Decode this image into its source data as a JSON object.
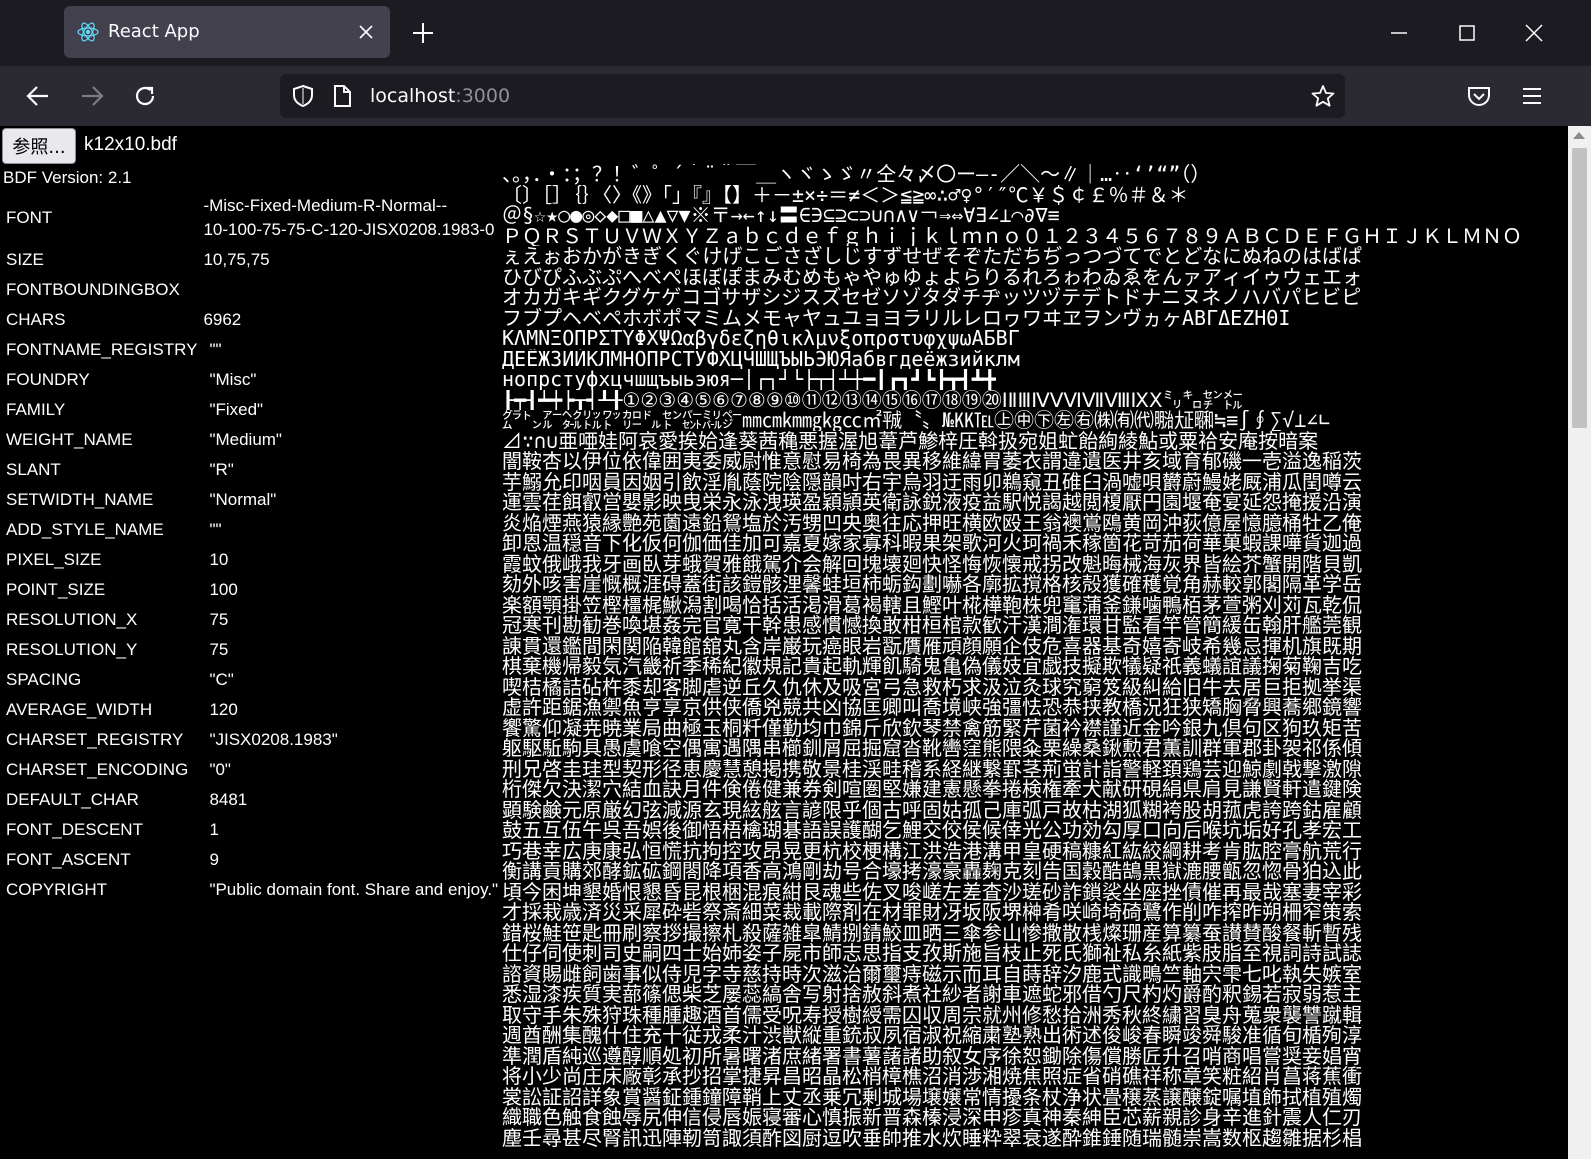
{
  "browser": {
    "tab_title": "React App",
    "url_host": "localhost",
    "url_port": ":3000"
  },
  "file_input": {
    "button_label": "参照...",
    "file_name": "k12x10.bdf"
  },
  "bdf_version": "BDF Version: 2.1",
  "properties": [
    {
      "key": "FONT",
      "value": "-Misc-Fixed-Medium-R-Normal--",
      "value2": "10-100-75-75-C-120-JISX0208.1983-0"
    },
    {
      "key": "SIZE",
      "value": "10,75,75"
    },
    {
      "key": "FONTBOUNDINGBOX",
      "value": ""
    },
    {
      "key": "CHARS",
      "value": "6962"
    },
    {
      "key": "FONTNAME_REGISTRY",
      "value": "\"\""
    },
    {
      "key": "FOUNDRY",
      "value": "\"Misc\""
    },
    {
      "key": "FAMILY",
      "value": "\"Fixed\""
    },
    {
      "key": "WEIGHT_NAME",
      "value": "\"Medium\""
    },
    {
      "key": "SLANT",
      "value": "\"R\""
    },
    {
      "key": "SETWIDTH_NAME",
      "value": "\"Normal\""
    },
    {
      "key": "ADD_STYLE_NAME",
      "value": "\"\""
    },
    {
      "key": "PIXEL_SIZE",
      "value": "10"
    },
    {
      "key": "POINT_SIZE",
      "value": "100"
    },
    {
      "key": "RESOLUTION_X",
      "value": "75"
    },
    {
      "key": "RESOLUTION_Y",
      "value": "75"
    },
    {
      "key": "SPACING",
      "value": "\"C\""
    },
    {
      "key": "AVERAGE_WIDTH",
      "value": "120"
    },
    {
      "key": "CHARSET_REGISTRY",
      "value": "\"JISX0208.1983\""
    },
    {
      "key": "CHARSET_ENCODING",
      "value": "\"0\""
    },
    {
      "key": "DEFAULT_CHAR",
      "value": "8481"
    },
    {
      "key": "FONT_DESCENT",
      "value": "1"
    },
    {
      "key": "FONT_ASCENT",
      "value": "9"
    },
    {
      "key": "COPYRIGHT",
      "value": "\"Public domain font. Share and enjoy.\""
    }
  ],
  "glyph_rows": [
    "、。，．・：；？！゛゜´｀¨＾￣＿ヽヾゝゞ〃仝々〆〇ー―‐／＼～∥｜…‥‘’“”（）",
    "〔〕［］｛｝〈〉《》「」『』【】＋－±×÷＝≠＜＞≦≧∞∴♂♀°′″℃￥＄￠￡％＃＆＊",
    "＠§☆★○●◎◇◆□■△▲▽▼※〒→←↑↓〓∈∋⊆⊇⊂⊃∪∩∧∨￢⇒⇔∀∃∠⊥⌒∂∇≡",
    "ＰＱＲＳＴＵＶＷＸＹＺａｂｃｄｅｆｇｈｉｊｋｌｍｎｏ０１２３４５６７８９ＡＢＣＤＥＦＧＨＩＪＫＬＭＮＯ",
    "ぇえぉおかがきぎくぐけげこごさざしじすずせぜそぞただちぢっつづてでとどなにぬねのはばぱ",
    "ひびぴふぶぷへべぺほぼぽまみむめもゃやゅゆょよらりるれろゎわゐゑをんァアィイゥウェエォ",
    "オカガキギクグケゲコゴサザシジスズセゼソゾタダチヂッツヅテデトドナニヌネノハバパヒビピ",
    "フブプヘベペホボポマミムメモャヤュユョヨラリルレロヮワヰヱヲンヴヵヶΑΒΓΔΕΖΗΘΙ",
    "ΚΛΜΝΞΟΠΡΣΤΥΦΧΨΩαβγδεζηθικλμνξοπρστυφχψωАБВГ",
    "ДЕЁЖЗИЙКЛМНОПРСТУФХЦЧШЩЪЫЬЭЮЯабвгдеёжзийклм",
    "нопрстуфхцчшщъыьэюя─│┌┐┘└├┬┤┴┼━┃┏┓┛┗┣┳┫┻╋",
    "┠┯┨┷┿┝┰┥┸╂①②③④⑤⑥⑦⑧⑨⑩⑪⑫⑬⑭⑮⑯⑰⑱⑲⑳ⅠⅡⅢⅣⅤⅥⅦⅧⅨⅩ㍉㌔㌢㍍",
    "㌘㌧㌃㌶㍑㍗㌍㌦㌣㌫㍊㌻㎜㎝㎞㎎㎏㏄㎡㍻〝〟№㏍℡㊤㊥㊦㊧㊨㈱㈲㈹㍾㍽㍼≒≡∫∮∑√⊥∠∟",
    "⊿∵∩∪亜唖娃阿哀愛挨姶逢葵茜穐悪握渥旭葦芦鯵梓圧斡扱宛姐虻飴絢綾鮎或粟袷安庵按暗案",
    "闇鞍杏以伊位依偉囲夷委威尉惟意慰易椅為畏異移維緯胃萎衣謂違遺医井亥域育郁磯一壱溢逸稲茨",
    "芋鰯允印咽員因姻引飲淫胤蔭院陰隠韻吋右宇烏羽迂雨卯鵜窺丑碓臼渦嘘唄欝蔚鰻姥厩浦瓜閏噂云",
    "運雲荏餌叡営嬰影映曳栄永泳洩瑛盈穎頴英衛詠鋭液疫益駅悦謁越閲榎厭円園堰奄宴延怨掩援沿演",
    "炎焔煙燕猿縁艶苑薗遠鉛鴛塩於汚甥凹央奥往応押旺横欧殴王翁襖鴬鴎黄岡沖荻億屋憶臆桶牡乙俺",
    "卸恩温穏音下化仮何伽価佳加可嘉夏嫁家寡科暇果架歌河火珂禍禾稼箇花苛茄荷華菓蝦課嘩貨迦過",
    "霞蚊俄峨我牙画臥芽蛾賀雅餓駕介会解回塊壊廻快怪悔恢懐戒拐改魁晦械海灰界皆絵芥蟹開階貝凱",
    "劾外咳害崖慨概涯碍蓋街該鎧骸浬馨蛙垣柿蛎鈎劃嚇各廓拡撹格核殻獲確穫覚角赫較郭閣隔革学岳",
    "楽額顎掛笠樫橿梶鰍潟割喝恰括活渇滑葛褐轄且鰹叶椛樺鞄株兜竃蒲釜鎌噛鴨栢茅萱粥刈苅瓦乾侃",
    "冠寒刊勘勧巻喚堪姦完官寛干幹患感慣憾換敢柑桓棺款歓汗漢澗潅環甘監看竿管簡緩缶翰肝艦莞観",
    "諌貫還鑑間閑関陥韓館舘丸含岸巌玩癌眼岩翫贋雁頑顔願企伎危喜器基奇嬉寄岐希幾忌揮机旗既期",
    "棋棄機帰毅気汽畿祈季稀紀徽規記貴起軌輝飢騎鬼亀偽儀妓宜戯技擬欺犠疑祇義蟻誼議掬菊鞠吉吃",
    "喫桔橘詰砧杵黍却客脚虐逆丘久仇休及吸宮弓急救朽求汲泣灸球究窮笈級糾給旧牛去居巨拒拠挙渠",
    "虚許距鋸漁禦魚亨享京供侠僑兇競共凶協匡卿叫喬境峡強彊怯恐恭挟教橋況狂狭矯胸脅興蕎郷鏡響",
    "饗驚仰凝尭暁業局曲極玉桐粁僅勤均巾錦斤欣欽琴禁禽筋緊芹菌衿襟謹近金吟銀九倶句区狗玖矩苦",
    "躯駆駈駒具愚虞喰空偶寓遇隅串櫛釧屑屈掘窟沓靴轡窪熊隈粂栗繰桑鍬勲君薫訓群軍郡卦袈祁係傾",
    "刑兄啓圭珪型契形径恵慶慧憩掲携敬景桂渓畦稽系経継繋罫茎荊蛍計詣警軽頚鶏芸迎鯨劇戟撃激隙",
    "桁傑欠決潔穴結血訣月件倹倦健兼券剣喧圏堅嫌建憲懸拳捲検権牽犬献研硯絹県肩見謙賢軒遣鍵険",
    "顕験鹸元原厳幻弦減源玄現絃舷言諺限乎個古呼固姑孤己庫弧戸故枯湖狐糊袴股胡菰虎誇跨鈷雇顧",
    "鼓五互伍午呉吾娯後御悟梧檎瑚碁語誤護醐乞鯉交佼侯候倖光公功効勾厚口向后喉坑垢好孔孝宏工",
    "巧巷幸広庚康弘恒慌抗拘控攻昂晃更杭校梗構江洪浩港溝甲皇硬稿糠紅紘絞綱耕考肯肱腔膏航荒行",
    "衡講貢購郊酵鉱砿鋼閤降項香高鴻剛劫号合壕拷濠豪轟麹克刻告国穀酷鵠黒獄漉腰甑忽惚骨狛込此",
    "頃今困坤墾婚恨懇昏昆根梱混痕紺艮魂些佐叉唆嵯左差査沙瑳砂詐鎖裟坐座挫債催再最哉塞妻宰彩",
    "才採栽歳済災采犀砕砦祭斎細菜裁載際剤在材罪財冴坂阪堺榊肴咲崎埼碕鷺作削咋搾昨朔柵窄策索",
    "錯桜鮭笹匙冊刷察拶撮擦札殺薩雑皐鯖捌錆鮫皿晒三傘参山惨撒散桟燦珊産算纂蚕讃賛酸餐斬暫残",
    "仕仔伺使刺司史嗣四士始姉姿子屍市師志思指支孜斯施旨枝止死氏獅祉私糸紙紫肢脂至視詞詩試誌",
    "諮資賜雌飼歯事似侍児字寺慈持時次滋治爾璽痔磁示而耳自蒔辞汐鹿式識鴫竺軸宍雫七叱執失嫉室",
    "悉湿漆疾質実蔀篠偲柴芝屡蕊縞舎写射捨赦斜煮社紗者謝車遮蛇邪借勺尺杓灼爵酌釈錫若寂弱惹主",
    "取守手朱殊狩珠種腫趣酒首儒受呪寿授樹綬需囚収周宗就州修愁拾洲秀秋終繍習臭舟蒐衆襲讐蹴輯",
    "週酋酬集醜什住充十従戎柔汁渋獣縦重銃叔夙宿淑祝縮粛塾熟出術述俊峻春瞬竣舜駿准循旬楯殉淳",
    "準潤盾純巡遵醇順処初所暑曙渚庶緒署書薯藷諸助叙女序徐恕鋤除傷償勝匠升召哨商唱嘗奨妾娼宵",
    "将小少尚庄床廠彰承抄招掌捷昇昌昭晶松梢樟樵沼消渉湘焼焦照症省硝礁祥称章笑粧紹肖菖蒋蕉衝",
    "裳訟証詔詳象賞醤鉦鍾鐘障鞘上丈丞乗冗剰城場壌嬢常情擾条杖浄状畳穣蒸譲醸錠嘱埴飾拭植殖燭",
    "織職色触食蝕辱尻伸信侵唇娠寝審心慎振新晋森榛浸深申疹真神秦紳臣芯薪親診身辛進針震人仁刃",
    "塵壬尋甚尽腎訊迅陣靭笥諏須酢図厨逗吹垂帥推水炊睡粋翠衰遂酔錐錘随瑞髄崇嵩数枢趨雛据杉椙"
  ]
}
